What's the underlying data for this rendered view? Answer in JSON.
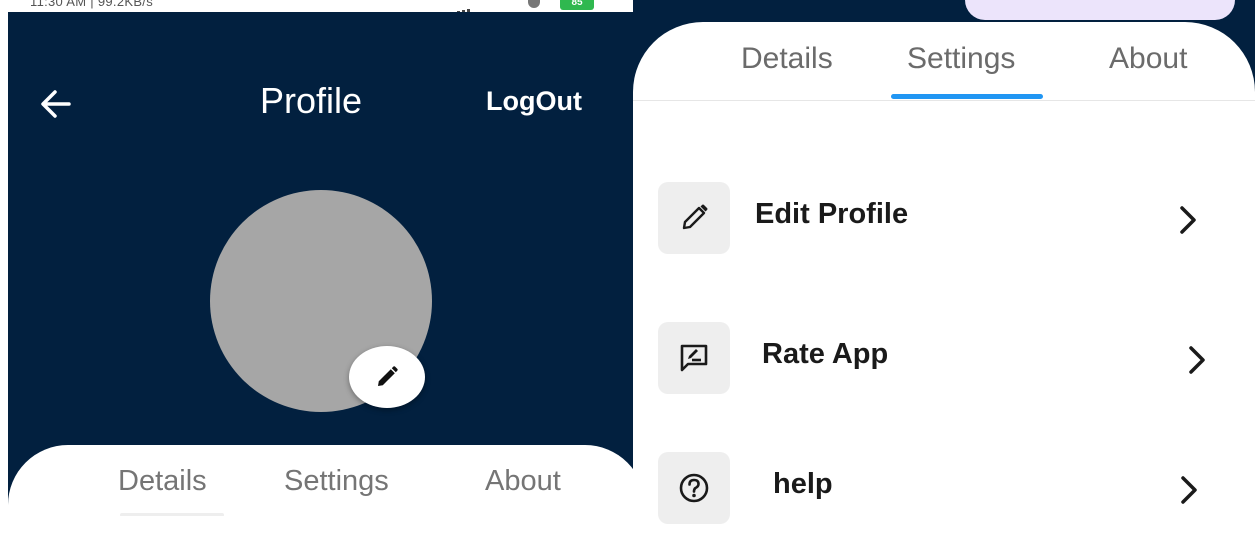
{
  "status_bar": {
    "left_text": "11:30 AM | 99.2KB/s",
    "battery": "85"
  },
  "header": {
    "title": "Profile",
    "logout_label": "LogOut"
  },
  "bottom_tabs": [
    {
      "label": "Details"
    },
    {
      "label": "Settings"
    },
    {
      "label": "About"
    }
  ],
  "settings_panel": {
    "tabs": [
      {
        "label": "Details"
      },
      {
        "label": "Settings",
        "active": true
      },
      {
        "label": "About"
      }
    ],
    "items": [
      {
        "label": "Edit Profile",
        "icon": "pencil-icon"
      },
      {
        "label": "Rate App",
        "icon": "rate-review-icon"
      },
      {
        "label": "help",
        "icon": "help-circle-icon"
      }
    ]
  },
  "colors": {
    "header_bg": "#02203f",
    "avatar": "#a6a6a6",
    "tab_indicator": "#2196f3",
    "icon_box": "#eeeeee"
  }
}
